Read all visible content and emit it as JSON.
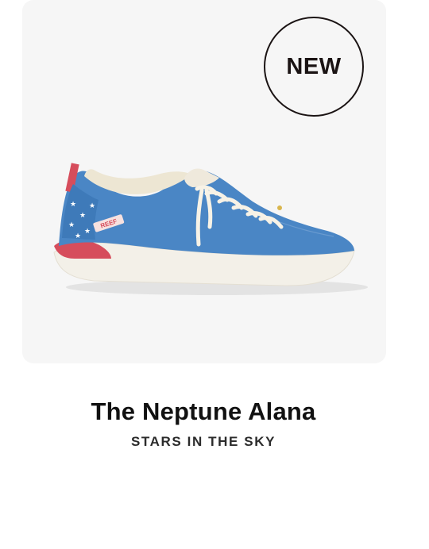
{
  "product": {
    "badge": "NEW",
    "title": "The Neptune Alana",
    "subtitle": "STARS IN THE SKY",
    "image": {
      "icon": "sneaker-image",
      "brand_tag": "REEF",
      "colors": {
        "upper": "#4a86c5",
        "sole": "#f4f1ea",
        "heel_accent": "#d64d5c",
        "laces": "#f7f2e6"
      }
    }
  }
}
